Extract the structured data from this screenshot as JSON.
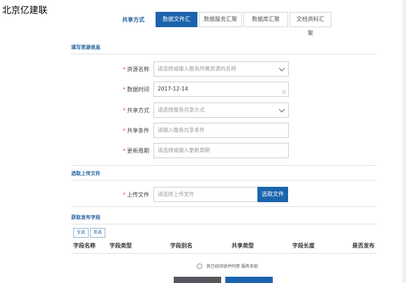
{
  "header": {
    "logo_text": "北京亿建联"
  },
  "share": {
    "label": "共享方式",
    "tabs": [
      {
        "label": "数据文件汇聚",
        "active": true
      },
      {
        "label": "数据服务汇聚",
        "active": false
      },
      {
        "label": "数据库汇聚",
        "active": false
      },
      {
        "label": "文档资料汇聚",
        "active": false
      }
    ]
  },
  "resource_section": {
    "title": "填写资源信息",
    "fields": {
      "name": {
        "required_mark": "*",
        "label": "资源名称",
        "placeholder": "请选择或输入服务所属资源的名称"
      },
      "time": {
        "required_mark": "*",
        "label": "数据时间",
        "value": "2017-12-14",
        "icon": "calendar-icon"
      },
      "share_mode": {
        "required_mark": "*",
        "label": "共享方式",
        "placeholder": "请选择服务共享方式"
      },
      "share_condition": {
        "required_mark": "*",
        "label": "共享条件",
        "placeholder": "请输入服务共享条件"
      },
      "update_cycle": {
        "required_mark": "*",
        "label": "更新周期",
        "placeholder": "请选择或输入更新周期"
      }
    }
  },
  "upload_section": {
    "title": "选取上传文件",
    "required_mark": "*",
    "label": "上传文件",
    "placeholder": "请选择上传文件",
    "button_label": "选取文件"
  },
  "publish_section": {
    "title": "获取发布字段",
    "select_all": "全选",
    "invert": "反选",
    "columns": [
      "字段名称",
      "字段类型",
      "字段别名",
      "共享类型",
      "字段长度",
      "是否发布"
    ]
  },
  "agreement": {
    "text": "我已经阅读并同意 服务条款"
  },
  "colors": {
    "accent": "#1b64ad",
    "required": "#d9534f",
    "section_title": "#1d5e9c"
  }
}
